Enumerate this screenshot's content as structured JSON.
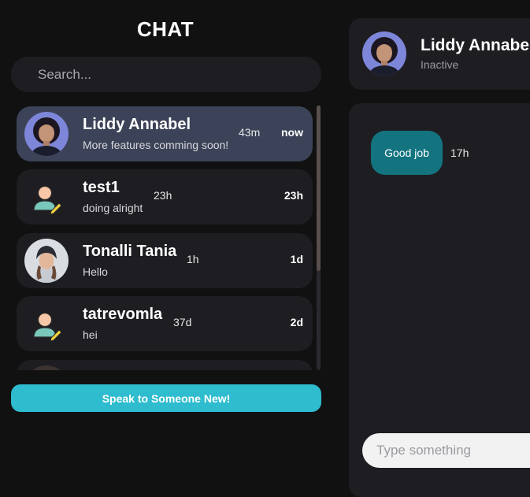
{
  "sidebar": {
    "title": "CHAT",
    "search": {
      "placeholder": "Search...",
      "value": ""
    },
    "conversations": [
      {
        "name": "Liddy Annabel",
        "last_message": "More features comming soon!",
        "ago": "43m",
        "when": "now",
        "avatar": "photo-woman-dark-hair",
        "active": true
      },
      {
        "name": "test1",
        "last_message": "doing alright",
        "ago": "23h",
        "when": "23h",
        "avatar": "user-edit-icon",
        "active": false
      },
      {
        "name": "Tonalli Tania",
        "last_message": "Hello",
        "ago": "1h",
        "when": "1d",
        "avatar": "photo-woman-beanie",
        "active": false
      },
      {
        "name": "tatrevomla",
        "last_message": "hei",
        "ago": "37d",
        "when": "2d",
        "avatar": "user-edit-icon",
        "active": false
      }
    ],
    "new_chat_button": "Speak to Someone New!"
  },
  "chat": {
    "contact_name": "Liddy Annabel",
    "contact_status": "Inactive",
    "messages": [
      {
        "text": "Good job",
        "time": "17h"
      }
    ],
    "composer": {
      "placeholder": "Type something",
      "value": ""
    }
  },
  "colors": {
    "background": "#111111",
    "panel": "#1e1e22",
    "active_item": "#3c4358",
    "accent_button": "#2fbccf",
    "message_bubble": "#137480"
  }
}
